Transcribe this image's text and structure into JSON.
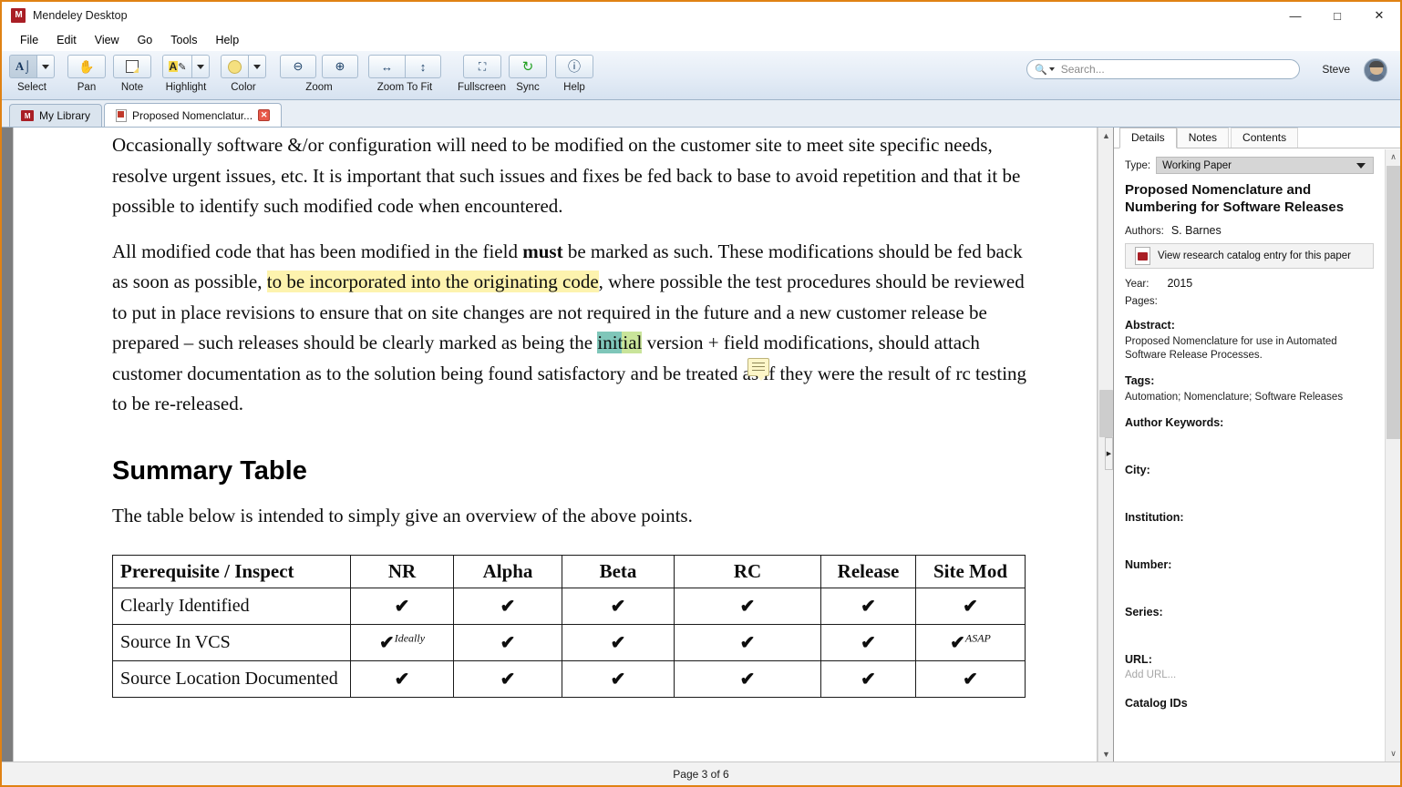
{
  "window": {
    "app_title": "Mendeley Desktop",
    "logo_glyph": "M",
    "minimize": "—",
    "maximize": "□",
    "close": "✕"
  },
  "menubar": {
    "items": [
      "File",
      "Edit",
      "View",
      "Go",
      "Tools",
      "Help"
    ]
  },
  "toolbar": {
    "groups": [
      {
        "label": "Select",
        "icon": "text-select-icon",
        "has_dropdown": true,
        "active": true
      },
      {
        "label": "Pan",
        "icon": "hand-icon",
        "has_dropdown": false,
        "active": false
      },
      {
        "label": "Note",
        "icon": "sticky-note-icon",
        "has_dropdown": false,
        "active": false
      },
      {
        "label": "Highlight",
        "icon": "highlighter-icon",
        "has_dropdown": true,
        "active": false
      },
      {
        "label": "Color",
        "icon": "color-swatch-icon",
        "has_dropdown": true,
        "active": false
      },
      {
        "label": "Zoom",
        "icon": "zoom-icons",
        "has_dropdown": false,
        "active": false
      },
      {
        "label": "Zoom To Fit",
        "icon": "fit-icons",
        "has_dropdown": false,
        "active": false
      },
      {
        "label": "Fullscreen",
        "icon": "fullscreen-icon",
        "has_dropdown": false,
        "active": false
      },
      {
        "label": "Sync",
        "icon": "sync-icon",
        "has_dropdown": false,
        "active": false
      },
      {
        "label": "Help",
        "icon": "help-icon",
        "has_dropdown": false,
        "active": false
      }
    ],
    "zoom_out_glyph": "⊖",
    "zoom_in_glyph": "⊕",
    "fit_width_glyph": "↔",
    "fit_height_glyph": "↕",
    "fullscreen_glyph": "⛶",
    "sync_glyph": "↻",
    "help_glyph": "?",
    "hand_glyph": "✋",
    "select_glyph": "A",
    "highlight_glyph": "A"
  },
  "search": {
    "placeholder": "Search...",
    "value": "",
    "icon": "search-icon"
  },
  "account": {
    "user_name": "Steve"
  },
  "document_tabs": [
    {
      "label": "My Library",
      "icon": "mendeley-icon",
      "active": false,
      "closable": false
    },
    {
      "label": "Proposed Nomenclatur...",
      "icon": "pdf-icon",
      "active": true,
      "closable": true,
      "close_glyph": "✕"
    }
  ],
  "document": {
    "paragraphs": [
      {
        "id": "para-occasionally",
        "runs": [
          {
            "text": "Occasionally software &/or configuration will need to be modified on the customer site to meet site specific needs, resolve urgent issues, etc. It is important that such issues and fixes be fed back to base to avoid repetition and that it be possible to identify such modified code when encountered.",
            "style": "normal"
          }
        ]
      },
      {
        "id": "para-allmodified",
        "runs": [
          {
            "text": "All modified code that has been modified in the field ",
            "style": "normal"
          },
          {
            "text": "must",
            "style": "bold"
          },
          {
            "text": " be marked as such. These modifications should be fed back as soon as possible, ",
            "style": "normal"
          },
          {
            "text": "to be incorporated into the originating code",
            "style": "highlight-yellow"
          },
          {
            "text": ", where possible the test procedures should be reviewed to put in place revisions to ensure that on site changes are not required in the future and a new customer release be prepared – such releases should be clearly marked as being the ",
            "style": "normal"
          },
          {
            "text": "initial",
            "style": "highlight-green"
          },
          {
            "text": " version + field modifications, should attach customer documentation as to the solution being found satisfactory and be treated as if they were the result of rc testing to be re-released.",
            "style": "normal"
          }
        ]
      }
    ],
    "heading": "Summary Table",
    "intro": "The table below is intended to simply give an overview of the above points.",
    "annotation_note": {
      "name": "sticky-note-annotation",
      "tooltip": ""
    },
    "table": {
      "headers": [
        "Prerequisite / Inspect",
        "NR",
        "Alpha",
        "Beta",
        "RC",
        "Release",
        "Site Mod"
      ],
      "rows": [
        {
          "label": "Clearly Identified",
          "cells": [
            {
              "tick": "✔",
              "sup": ""
            },
            {
              "tick": "✔",
              "sup": ""
            },
            {
              "tick": "✔",
              "sup": ""
            },
            {
              "tick": "✔",
              "sup": ""
            },
            {
              "tick": "✔",
              "sup": ""
            },
            {
              "tick": "✔",
              "sup": ""
            }
          ]
        },
        {
          "label": "Source In VCS",
          "cells": [
            {
              "tick": "✔",
              "sup": "Ideally"
            },
            {
              "tick": "✔",
              "sup": ""
            },
            {
              "tick": "✔",
              "sup": ""
            },
            {
              "tick": "✔",
              "sup": ""
            },
            {
              "tick": "✔",
              "sup": ""
            },
            {
              "tick": "✔",
              "sup": "ASAP"
            }
          ]
        },
        {
          "label": "Source Location Documented",
          "cells": [
            {
              "tick": "✔",
              "sup": ""
            },
            {
              "tick": "✔",
              "sup": ""
            },
            {
              "tick": "✔",
              "sup": ""
            },
            {
              "tick": "✔",
              "sup": ""
            },
            {
              "tick": "✔",
              "sup": ""
            },
            {
              "tick": "✔",
              "sup": ""
            }
          ]
        }
      ]
    }
  },
  "details_panel": {
    "tabs": [
      {
        "label": "Details",
        "active": true
      },
      {
        "label": "Notes",
        "active": false
      },
      {
        "label": "Contents",
        "active": false
      }
    ],
    "type_label": "Type:",
    "type_value": "Working Paper",
    "title": "Proposed Nomenclature and Numbering for Software Releases",
    "authors_label": "Authors:",
    "authors_value": "S. Barnes",
    "catalog_button": "View research catalog entry for this paper",
    "year_label": "Year:",
    "year_value": "2015",
    "pages_label": "Pages:",
    "pages_value": "",
    "abstract_label": "Abstract:",
    "abstract_value": "Proposed Nomenclature for use in Automated Software Release Processes.",
    "tags_label": "Tags:",
    "tags_value": "Automation; Nomenclature; Software Releases",
    "author_keywords_label": "Author Keywords:",
    "author_keywords_value": "",
    "city_label": "City:",
    "city_value": "",
    "institution_label": "Institution:",
    "institution_value": "",
    "number_label": "Number:",
    "number_value": "",
    "series_label": "Series:",
    "series_value": "",
    "url_label": "URL:",
    "url_placeholder": "Add URL...",
    "catalog_ids_label": "Catalog IDs",
    "scroll_up_glyph": "∧",
    "scroll_down_glyph": "∨"
  },
  "statusbar": {
    "page_text": "Page 3 of 6"
  },
  "colors": {
    "window_border": "#e08214",
    "brand_red": "#a91e25",
    "highlight_yellow": "#fdf3ae",
    "highlight_green": "#7fc6b9",
    "sync_green": "#23a021",
    "tab_close_red": "#e8594a"
  }
}
